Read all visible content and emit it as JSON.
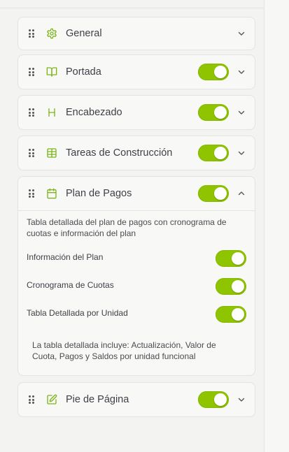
{
  "theme": {
    "accent": "#8fc400",
    "icon_color": "#7cb518"
  },
  "sections": [
    {
      "title": "General",
      "icon": "gear-icon",
      "has_toggle": false,
      "enabled": null,
      "expanded": false
    },
    {
      "title": "Portada",
      "icon": "book-open-icon",
      "has_toggle": true,
      "enabled": true,
      "expanded": false
    },
    {
      "title": "Encabezado",
      "icon": "heading-icon",
      "has_toggle": true,
      "enabled": true,
      "expanded": false
    },
    {
      "title": "Tareas de Construcción",
      "icon": "table-icon",
      "has_toggle": true,
      "enabled": true,
      "expanded": false
    },
    {
      "title": "Plan de Pagos",
      "icon": "calendar-icon",
      "has_toggle": true,
      "enabled": true,
      "expanded": true
    },
    {
      "title": "Pie de Página",
      "icon": "edit-document-icon",
      "has_toggle": true,
      "enabled": true,
      "expanded": false
    }
  ],
  "plan_de_pagos": {
    "description": "Tabla detallada del plan de pagos con cronograma de cuotas e información del plan",
    "options": [
      {
        "label": "Información del Plan",
        "enabled": true
      },
      {
        "label": "Cronograma de Cuotas",
        "enabled": true
      },
      {
        "label": "Tabla Detallada por Unidad",
        "enabled": true
      }
    ],
    "note": "La tabla detallada incluye: Actualización, Valor de Cuota, Pagos y Saldos por unidad funcional"
  }
}
